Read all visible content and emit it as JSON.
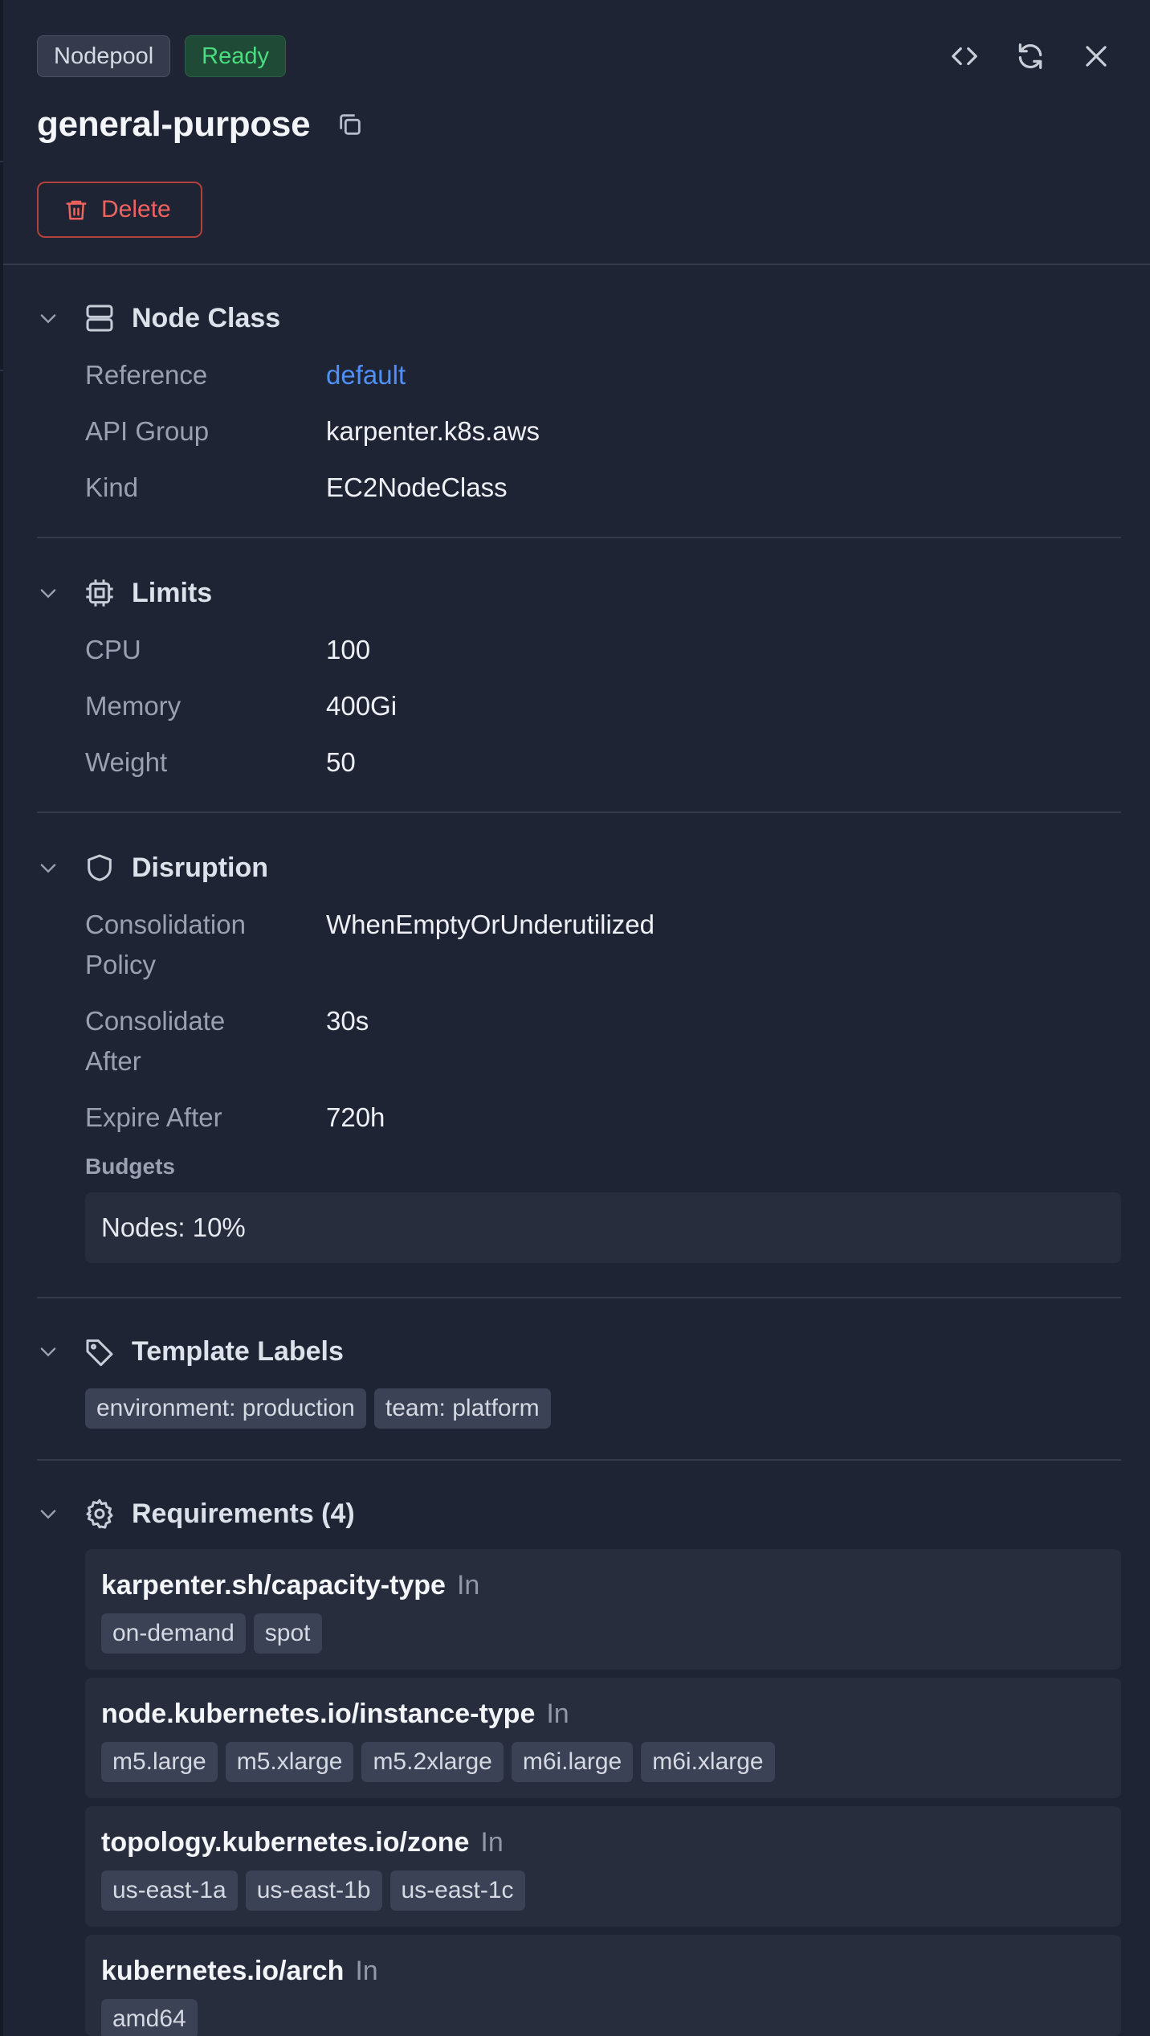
{
  "header": {
    "kind_badge": "Nodepool",
    "status_badge": "Ready",
    "title": "general-purpose",
    "delete_label": "Delete"
  },
  "colors": {
    "background": "#1f2434",
    "status_ready": "#4ade80",
    "danger": "#f0625d",
    "link": "#4f8ff7"
  },
  "node_class": {
    "title": "Node Class",
    "rows": [
      {
        "key": "Reference",
        "value": "default"
      },
      {
        "key": "API Group",
        "value": "karpenter.k8s.aws"
      },
      {
        "key": "Kind",
        "value": "EC2NodeClass"
      }
    ]
  },
  "limits": {
    "title": "Limits",
    "rows": [
      {
        "key": "CPU",
        "value": "100"
      },
      {
        "key": "Memory",
        "value": "400Gi"
      },
      {
        "key": "Weight",
        "value": "50"
      }
    ]
  },
  "disruption": {
    "title": "Disruption",
    "consolidation_policy_key_1": "Consolidation",
    "consolidation_policy_key_2": "Policy",
    "consolidation_policy_value": "WhenEmptyOrUnderutilized",
    "consolidate_after_key_1": "Consolidate",
    "consolidate_after_key_2": "After",
    "consolidate_after_value": "30s",
    "expire_after_key": "Expire After",
    "expire_after_value": "720h",
    "budgets_label": "Budgets",
    "budget_item": "Nodes: 10%"
  },
  "template_labels": {
    "title": "Template Labels",
    "labels": [
      "environment: production",
      "team: platform"
    ]
  },
  "requirements": {
    "title": "Requirements (4)",
    "items": [
      {
        "key": "karpenter.sh/capacity-type",
        "operator": "In",
        "values": [
          "on-demand",
          "spot"
        ]
      },
      {
        "key": "node.kubernetes.io/instance-type",
        "operator": "In",
        "values": [
          "m5.large",
          "m5.xlarge",
          "m5.2xlarge",
          "m6i.large",
          "m6i.xlarge"
        ]
      },
      {
        "key": "topology.kubernetes.io/zone",
        "operator": "In",
        "values": [
          "us-east-1a",
          "us-east-1b",
          "us-east-1c"
        ]
      },
      {
        "key": "kubernetes.io/arch",
        "operator": "In",
        "values": [
          "amd64"
        ]
      }
    ]
  },
  "icons": {
    "view_source": "code-icon",
    "refresh": "refresh-icon",
    "close": "close-icon",
    "copy": "copy-icon",
    "delete": "trash-icon",
    "node_class": "server-icon",
    "limits": "cpu-icon",
    "disruption": "shield-icon",
    "template_labels": "tag-icon",
    "requirements": "gear-icon"
  }
}
